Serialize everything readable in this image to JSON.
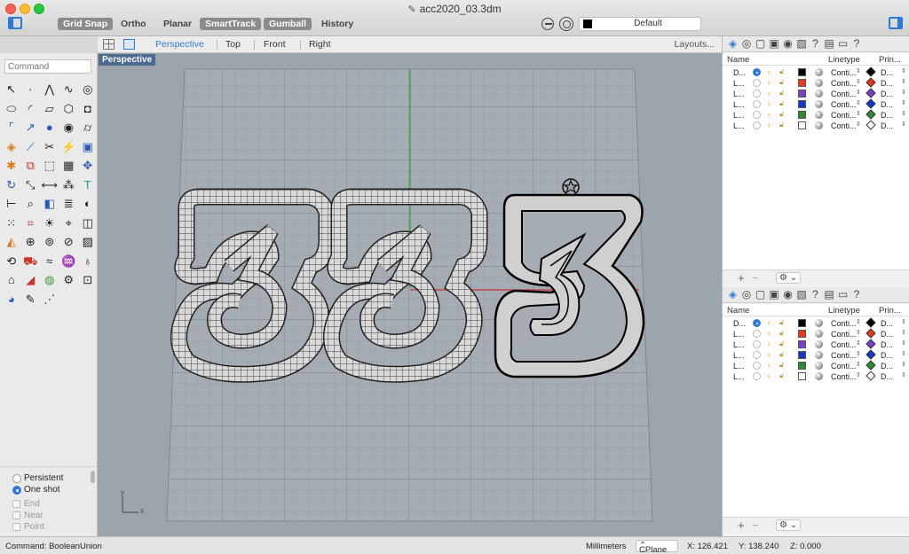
{
  "window": {
    "title": "acc2020_03.3dm",
    "title_icon": "rhino-file-icon"
  },
  "toolbar": {
    "modes": [
      {
        "label": "Grid Snap",
        "on": true
      },
      {
        "label": "Ortho",
        "on": false
      },
      {
        "label": "Planar",
        "on": false
      },
      {
        "label": "SmartTrack",
        "on": true
      },
      {
        "label": "Gumball",
        "on": true
      },
      {
        "label": "History",
        "on": false
      }
    ],
    "current_layer": {
      "name": "Default",
      "color": "#000000"
    }
  },
  "viewbar": {
    "tabs": [
      {
        "label": "Perspective",
        "active": true
      },
      {
        "label": "Top",
        "active": false
      },
      {
        "label": "Front",
        "active": false
      },
      {
        "label": "Right",
        "active": false
      }
    ],
    "layouts_label": "Layouts..."
  },
  "command": {
    "placeholder": "Command"
  },
  "tools": [
    {
      "name": "select-points-icon",
      "glyph": "↖",
      "color": ""
    },
    {
      "name": "point-icon",
      "glyph": "·",
      "color": ""
    },
    {
      "name": "polyline-icon",
      "glyph": "⋀",
      "color": ""
    },
    {
      "name": "curve-icon",
      "glyph": "∿",
      "color": ""
    },
    {
      "name": "circle-icon",
      "glyph": "◎",
      "color": ""
    },
    {
      "name": "ellipse-icon",
      "glyph": "⬭",
      "color": ""
    },
    {
      "name": "arc-icon",
      "glyph": "◜",
      "color": ""
    },
    {
      "name": "rectangle-icon",
      "glyph": "▱",
      "color": ""
    },
    {
      "name": "polygon-icon",
      "glyph": "⬡",
      "color": ""
    },
    {
      "name": "solid-box-icon",
      "glyph": "◘",
      "color": ""
    },
    {
      "name": "fillet-curves-icon",
      "glyph": "⌜",
      "color": "c-blue"
    },
    {
      "name": "extend-curve-icon",
      "glyph": "↗",
      "color": "c-blue"
    },
    {
      "name": "sphere-icon",
      "glyph": "●",
      "color": "c-blue"
    },
    {
      "name": "solid-edit-icon",
      "glyph": "◉",
      "color": ""
    },
    {
      "name": "cylinder-icon",
      "glyph": "⌭",
      "color": ""
    },
    {
      "name": "surface-from-curves-icon",
      "glyph": "◈",
      "color": "c-orange"
    },
    {
      "name": "offset-icon",
      "glyph": "⟋",
      "color": "c-blue"
    },
    {
      "name": "trim-icon",
      "glyph": "✂",
      "color": ""
    },
    {
      "name": "split-icon",
      "glyph": "⚡",
      "color": "c-orange"
    },
    {
      "name": "boolean-icon",
      "glyph": "▣",
      "color": "c-blue"
    },
    {
      "name": "explode-icon",
      "glyph": "✱",
      "color": "c-orange"
    },
    {
      "name": "join-icon",
      "glyph": "⧉",
      "color": "c-red"
    },
    {
      "name": "group-icon",
      "glyph": "⬚",
      "color": ""
    },
    {
      "name": "mesh-icon",
      "glyph": "▦",
      "color": ""
    },
    {
      "name": "move-icon",
      "glyph": "✥",
      "color": "c-blue"
    },
    {
      "name": "rotate-icon",
      "glyph": "↻",
      "color": "c-blue"
    },
    {
      "name": "scale-icon",
      "glyph": "⤡",
      "color": ""
    },
    {
      "name": "mirror-icon",
      "glyph": "⟷",
      "color": ""
    },
    {
      "name": "array-icon",
      "glyph": "⁂",
      "color": ""
    },
    {
      "name": "text-icon",
      "glyph": "T",
      "color": "c-teal"
    },
    {
      "name": "dimension-icon",
      "glyph": "⊢",
      "color": ""
    },
    {
      "name": "analyze-icon",
      "glyph": "⌕",
      "color": ""
    },
    {
      "name": "block-icon",
      "glyph": "◧",
      "color": "c-blue"
    },
    {
      "name": "layer-tool-icon",
      "glyph": "≣",
      "color": ""
    },
    {
      "name": "hide-icon",
      "glyph": "◐",
      "color": ""
    },
    {
      "name": "grid-array-icon",
      "glyph": "⁙",
      "color": ""
    },
    {
      "name": "render-icon",
      "glyph": "⌗",
      "color": "c-red"
    },
    {
      "name": "light-icon",
      "glyph": "☀",
      "color": ""
    },
    {
      "name": "camera-icon",
      "glyph": "⌖",
      "color": ""
    },
    {
      "name": "named-view-icon",
      "glyph": "◫",
      "color": ""
    },
    {
      "name": "material-icon",
      "glyph": "◭",
      "color": "c-orange"
    },
    {
      "name": "zoom-icon",
      "glyph": "⊕",
      "color": ""
    },
    {
      "name": "lasso-icon",
      "glyph": "⊚",
      "color": ""
    },
    {
      "name": "loft-icon",
      "glyph": "⊘",
      "color": ""
    },
    {
      "name": "cage-icon",
      "glyph": "▨",
      "color": ""
    },
    {
      "name": "bend-icon",
      "glyph": "⟲",
      "color": ""
    },
    {
      "name": "car-icon",
      "glyph": "⛟",
      "color": "c-red"
    },
    {
      "name": "flow-icon",
      "glyph": "≈",
      "color": ""
    },
    {
      "name": "twist-icon",
      "glyph": "♒",
      "color": ""
    },
    {
      "name": "bulb-icon",
      "glyph": "♁",
      "color": ""
    },
    {
      "name": "lock-icon",
      "glyph": "⌂",
      "color": ""
    },
    {
      "name": "shade-icon",
      "glyph": "◢",
      "color": "c-red"
    },
    {
      "name": "color-wheel-icon",
      "glyph": "◍",
      "color": "c-green"
    },
    {
      "name": "settings-tool-icon",
      "glyph": "⚙",
      "color": ""
    },
    {
      "name": "selection-box-icon",
      "glyph": "⊡",
      "color": ""
    },
    {
      "name": "environment-icon",
      "glyph": "◕",
      "color": "c-blue"
    },
    {
      "name": "pen-icon",
      "glyph": "✎",
      "color": ""
    },
    {
      "name": "annotate-icon",
      "glyph": "⋰",
      "color": ""
    }
  ],
  "options": {
    "radios": [
      {
        "label": "Persistent",
        "checked": false
      },
      {
        "label": "One shot",
        "checked": true
      }
    ],
    "checks": [
      {
        "label": "End"
      },
      {
        "label": "Near"
      },
      {
        "label": "Point"
      }
    ]
  },
  "viewport": {
    "label": "Perspective",
    "axis_y": "y",
    "axis_x": "x"
  },
  "layers_panel": {
    "col_name": "Name",
    "col_linetype": "Linetype",
    "col_print": "Prin...",
    "rows": [
      {
        "name": "D...",
        "current": true,
        "color": "#000000",
        "linetype": "Conti...",
        "print_color": "#000000",
        "print": "D..."
      },
      {
        "name": "L...",
        "current": false,
        "color": "#e83a1d",
        "linetype": "Conti...",
        "print_color": "#e83a1d",
        "print": "D..."
      },
      {
        "name": "L...",
        "current": false,
        "color": "#7c3fc8",
        "linetype": "Conti...",
        "print_color": "#7c3fc8",
        "print": "D..."
      },
      {
        "name": "L...",
        "current": false,
        "color": "#1638c9",
        "linetype": "Conti...",
        "print_color": "#1638c9",
        "print": "D..."
      },
      {
        "name": "L...",
        "current": false,
        "color": "#2e8a2e",
        "linetype": "Conti...",
        "print_color": "#2e8a2e",
        "print": "D..."
      },
      {
        "name": "L...",
        "current": false,
        "color": "#ffffff",
        "linetype": "Conti...",
        "print_color": "#ffffff",
        "print": "D..."
      }
    ]
  },
  "panel_tab_icons": [
    "layers-icon",
    "render-panel-icon",
    "document-icon",
    "materials-icon",
    "camera-panel-icon",
    "display-icon",
    "help-panel-icon",
    "properties-icon",
    "monitor-icon",
    "help-icon"
  ],
  "statusbar": {
    "command": "Command: BooleanUnion",
    "units": "Millimeters",
    "cplane": "CPlane",
    "x": "X: 126.421",
    "y": "Y: 138.240",
    "z": "Z: 0.000"
  }
}
